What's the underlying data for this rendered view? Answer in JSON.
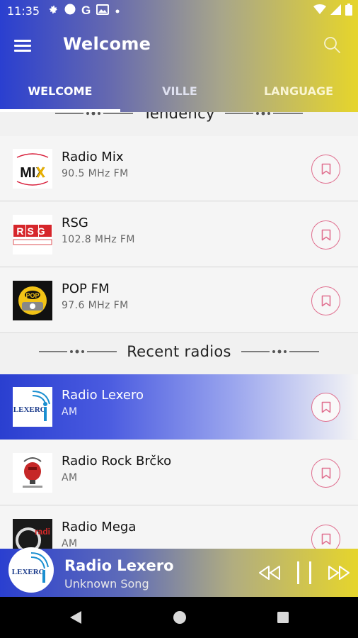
{
  "status_bar": {
    "time": "11:35",
    "left_icons": [
      "gear-icon",
      "circle-icon",
      "google-icon",
      "image-icon",
      "dot-icon"
    ],
    "right_icons": [
      "wifi-icon",
      "signal-icon",
      "battery-icon"
    ]
  },
  "toolbar": {
    "title": "Welcome"
  },
  "tabs": [
    {
      "label": "WELCOME",
      "selected": true
    },
    {
      "label": "VILLE",
      "selected": false
    },
    {
      "label": "LANGUAGE",
      "selected": false
    }
  ],
  "sections": {
    "tendency": {
      "title": "Tendency"
    },
    "recent": {
      "title": "Recent radios"
    }
  },
  "tendency_stations": [
    {
      "name": "Radio Mix",
      "frequency": "90.5 MHz FM",
      "logo_text": "MIX"
    },
    {
      "name": "RSG",
      "frequency": "102.8 MHz FM",
      "logo_text": "RSG"
    },
    {
      "name": "POP FM",
      "frequency": "97.6 MHz FM",
      "logo_text": "POP"
    }
  ],
  "recent_stations": [
    {
      "name": "Radio Lexero",
      "band": "AM",
      "logo_text": "LEXERO",
      "active": true
    },
    {
      "name": "Radio Rock Brčko",
      "band": "AM",
      "logo_text": "",
      "active": false
    },
    {
      "name": "Radio Mega",
      "band": "AM",
      "logo_text": "radi",
      "active": false
    }
  ],
  "player": {
    "station": "Radio Lexero",
    "song": "Unknown Song",
    "logo_text": "LEXERO"
  },
  "colors": {
    "gradient_start": "#2a3fd0",
    "gradient_end": "#e6d52b",
    "favorite_accent": "#e07090"
  }
}
